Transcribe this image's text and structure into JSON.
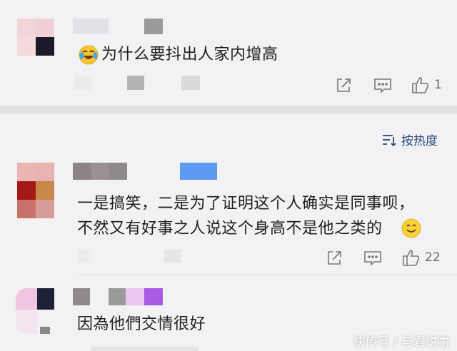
{
  "comments": [
    {
      "text": "为什么要抖出人家内增高",
      "likes": "1",
      "emoji": "laughing-tears"
    },
    {
      "text_lines": [
        "一是搞笑，二是为了证明这个人确实是同事呗，",
        "不然又有好事之人说这个身高不是他之类的"
      ],
      "likes": "22",
      "emoji": "smile"
    },
    {
      "text": "因為他們交情很好"
    }
  ],
  "sort": {
    "label": "按热度"
  },
  "watermark": "快传号 / 与君说事",
  "colors": {
    "background": "#f2f2f4",
    "divider": "#e1e1e4",
    "sort_accent": "#2c4a7a",
    "blue_badge": "#5b9cf0",
    "purple_badge": "#a85ce6"
  },
  "icons": [
    "share-icon",
    "comment-icon",
    "thumbs-up-icon",
    "sort-icon",
    "laughing-emoji-icon",
    "smile-emoji-icon"
  ]
}
